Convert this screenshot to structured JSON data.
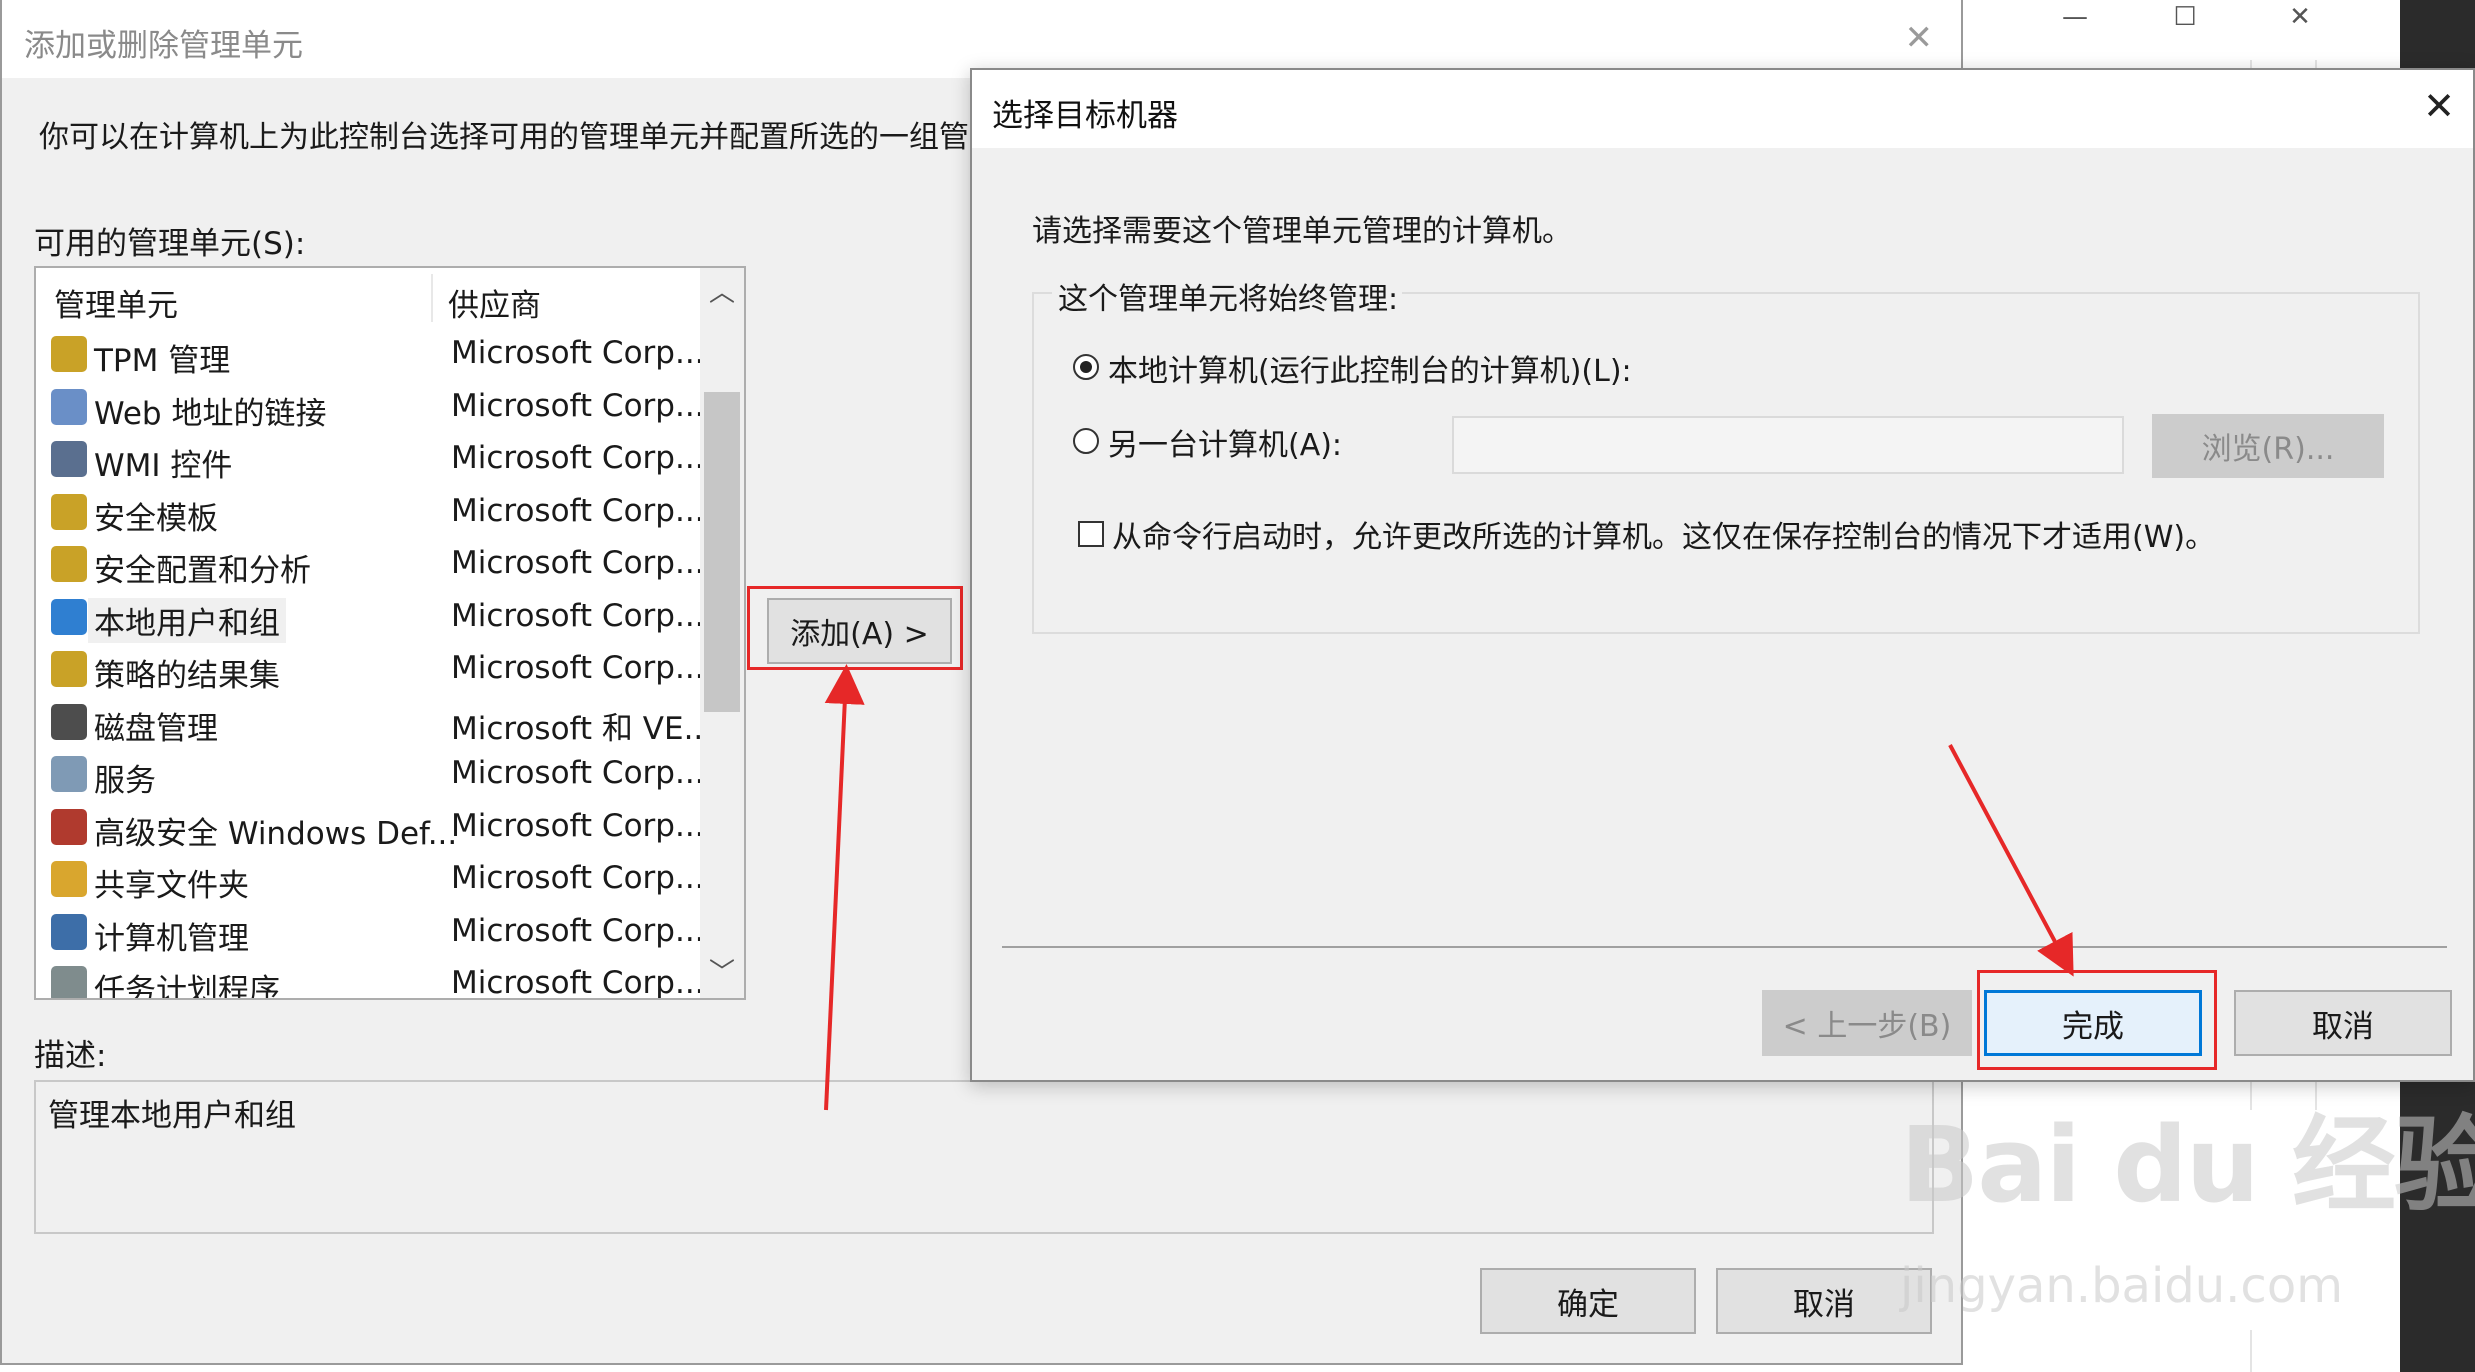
{
  "background_window": {
    "min_icon": "minimize-icon",
    "max_icon": "maximize-icon",
    "close_icon": "close-icon"
  },
  "main_dialog": {
    "title": "添加或删除管理单元",
    "intro": "你可以在计算机上为此控制台选择可用的管理单元并配置所选的一组管",
    "available_label": "可用的管理单元(S):",
    "columns": {
      "snapin": "管理单元",
      "vendor": "供应商"
    },
    "items": [
      {
        "name": "TPM 管理",
        "vendor": "Microsoft Corp...",
        "icon": "tpm-icon",
        "color": "#c9a227"
      },
      {
        "name": "Web 地址的链接",
        "vendor": "Microsoft Corp...",
        "icon": "web-link-icon",
        "color": "#6a8fc7"
      },
      {
        "name": "WMI 控件",
        "vendor": "Microsoft Corp...",
        "icon": "wmi-icon",
        "color": "#5a6f8f"
      },
      {
        "name": "安全模板",
        "vendor": "Microsoft Corp...",
        "icon": "security-template-icon",
        "color": "#c9a227"
      },
      {
        "name": "安全配置和分析",
        "vendor": "Microsoft Corp...",
        "icon": "security-analysis-icon",
        "color": "#c9a227"
      },
      {
        "name": "本地用户和组",
        "vendor": "Microsoft Corp...",
        "icon": "users-groups-icon",
        "color": "#2f7fd1",
        "selected": true
      },
      {
        "name": "策略的结果集",
        "vendor": "Microsoft Corp...",
        "icon": "policy-icon",
        "color": "#c9a227"
      },
      {
        "name": "磁盘管理",
        "vendor": "Microsoft 和 VE...",
        "icon": "disk-icon",
        "color": "#4d4d4d"
      },
      {
        "name": "服务",
        "vendor": "Microsoft Corp...",
        "icon": "services-icon",
        "color": "#7f9ab5"
      },
      {
        "name": "高级安全 Windows Def...",
        "vendor": "Microsoft Corp...",
        "icon": "firewall-icon",
        "color": "#b03a2e"
      },
      {
        "name": "共享文件夹",
        "vendor": "Microsoft Corp...",
        "icon": "shared-folder-icon",
        "color": "#d9a62e"
      },
      {
        "name": "计算机管理",
        "vendor": "Microsoft Corp...",
        "icon": "computer-mgmt-icon",
        "color": "#3d6ea8"
      },
      {
        "name": "任务计划程序",
        "vendor": "Microsoft Corp...",
        "icon": "task-scheduler-icon",
        "color": "#7f8c8d"
      }
    ],
    "add_button": "添加(A) >",
    "description_label": "描述:",
    "description_text": "管理本地用户和组",
    "ok_button": "确定",
    "cancel_button": "取消"
  },
  "target_dialog": {
    "title": "选择目标机器",
    "prompt": "请选择需要这个管理单元管理的计算机。",
    "group_label": "这个管理单元将始终管理:",
    "option_local": "本地计算机(运行此控制台的计算机)(L):",
    "option_other": "另一台计算机(A):",
    "other_value": "",
    "browse_button": "浏览(R)...",
    "checkbox_label": "从命令行启动时，允许更改所选的计算机。这仅在保存控制台的情况下才适用(W)。",
    "back_button": "< 上一步(B)",
    "finish_button": "完成",
    "cancel_button": "取消"
  },
  "annotation_color": "#e62828",
  "watermark": {
    "logo": "Bai du 经验",
    "site": "jingyan.baidu.com"
  }
}
